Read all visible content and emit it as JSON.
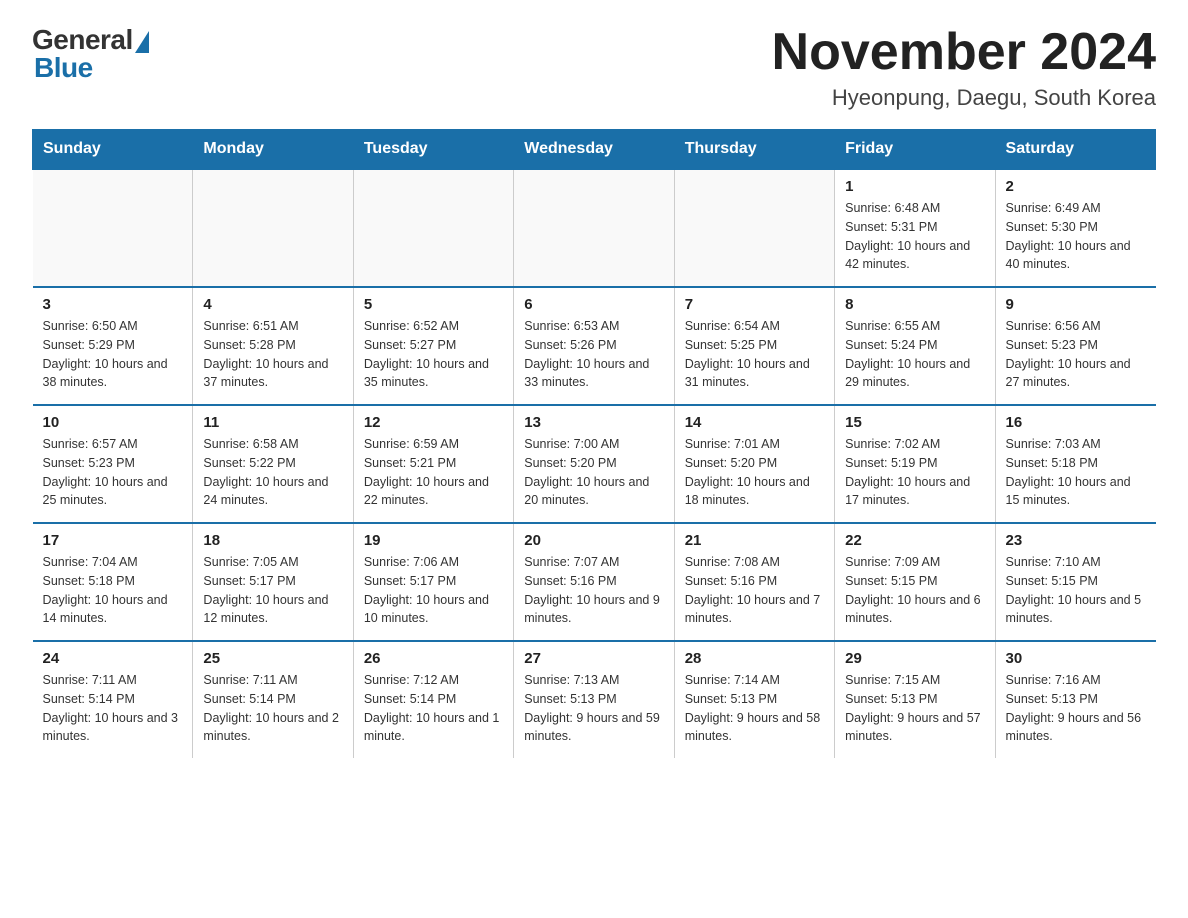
{
  "header": {
    "logo_general": "General",
    "logo_blue": "Blue",
    "month_year": "November 2024",
    "location": "Hyeonpung, Daegu, South Korea"
  },
  "days_of_week": [
    "Sunday",
    "Monday",
    "Tuesday",
    "Wednesday",
    "Thursday",
    "Friday",
    "Saturday"
  ],
  "weeks": [
    [
      {
        "num": "",
        "info": ""
      },
      {
        "num": "",
        "info": ""
      },
      {
        "num": "",
        "info": ""
      },
      {
        "num": "",
        "info": ""
      },
      {
        "num": "",
        "info": ""
      },
      {
        "num": "1",
        "info": "Sunrise: 6:48 AM\nSunset: 5:31 PM\nDaylight: 10 hours and 42 minutes."
      },
      {
        "num": "2",
        "info": "Sunrise: 6:49 AM\nSunset: 5:30 PM\nDaylight: 10 hours and 40 minutes."
      }
    ],
    [
      {
        "num": "3",
        "info": "Sunrise: 6:50 AM\nSunset: 5:29 PM\nDaylight: 10 hours and 38 minutes."
      },
      {
        "num": "4",
        "info": "Sunrise: 6:51 AM\nSunset: 5:28 PM\nDaylight: 10 hours and 37 minutes."
      },
      {
        "num": "5",
        "info": "Sunrise: 6:52 AM\nSunset: 5:27 PM\nDaylight: 10 hours and 35 minutes."
      },
      {
        "num": "6",
        "info": "Sunrise: 6:53 AM\nSunset: 5:26 PM\nDaylight: 10 hours and 33 minutes."
      },
      {
        "num": "7",
        "info": "Sunrise: 6:54 AM\nSunset: 5:25 PM\nDaylight: 10 hours and 31 minutes."
      },
      {
        "num": "8",
        "info": "Sunrise: 6:55 AM\nSunset: 5:24 PM\nDaylight: 10 hours and 29 minutes."
      },
      {
        "num": "9",
        "info": "Sunrise: 6:56 AM\nSunset: 5:23 PM\nDaylight: 10 hours and 27 minutes."
      }
    ],
    [
      {
        "num": "10",
        "info": "Sunrise: 6:57 AM\nSunset: 5:23 PM\nDaylight: 10 hours and 25 minutes."
      },
      {
        "num": "11",
        "info": "Sunrise: 6:58 AM\nSunset: 5:22 PM\nDaylight: 10 hours and 24 minutes."
      },
      {
        "num": "12",
        "info": "Sunrise: 6:59 AM\nSunset: 5:21 PM\nDaylight: 10 hours and 22 minutes."
      },
      {
        "num": "13",
        "info": "Sunrise: 7:00 AM\nSunset: 5:20 PM\nDaylight: 10 hours and 20 minutes."
      },
      {
        "num": "14",
        "info": "Sunrise: 7:01 AM\nSunset: 5:20 PM\nDaylight: 10 hours and 18 minutes."
      },
      {
        "num": "15",
        "info": "Sunrise: 7:02 AM\nSunset: 5:19 PM\nDaylight: 10 hours and 17 minutes."
      },
      {
        "num": "16",
        "info": "Sunrise: 7:03 AM\nSunset: 5:18 PM\nDaylight: 10 hours and 15 minutes."
      }
    ],
    [
      {
        "num": "17",
        "info": "Sunrise: 7:04 AM\nSunset: 5:18 PM\nDaylight: 10 hours and 14 minutes."
      },
      {
        "num": "18",
        "info": "Sunrise: 7:05 AM\nSunset: 5:17 PM\nDaylight: 10 hours and 12 minutes."
      },
      {
        "num": "19",
        "info": "Sunrise: 7:06 AM\nSunset: 5:17 PM\nDaylight: 10 hours and 10 minutes."
      },
      {
        "num": "20",
        "info": "Sunrise: 7:07 AM\nSunset: 5:16 PM\nDaylight: 10 hours and 9 minutes."
      },
      {
        "num": "21",
        "info": "Sunrise: 7:08 AM\nSunset: 5:16 PM\nDaylight: 10 hours and 7 minutes."
      },
      {
        "num": "22",
        "info": "Sunrise: 7:09 AM\nSunset: 5:15 PM\nDaylight: 10 hours and 6 minutes."
      },
      {
        "num": "23",
        "info": "Sunrise: 7:10 AM\nSunset: 5:15 PM\nDaylight: 10 hours and 5 minutes."
      }
    ],
    [
      {
        "num": "24",
        "info": "Sunrise: 7:11 AM\nSunset: 5:14 PM\nDaylight: 10 hours and 3 minutes."
      },
      {
        "num": "25",
        "info": "Sunrise: 7:11 AM\nSunset: 5:14 PM\nDaylight: 10 hours and 2 minutes."
      },
      {
        "num": "26",
        "info": "Sunrise: 7:12 AM\nSunset: 5:14 PM\nDaylight: 10 hours and 1 minute."
      },
      {
        "num": "27",
        "info": "Sunrise: 7:13 AM\nSunset: 5:13 PM\nDaylight: 9 hours and 59 minutes."
      },
      {
        "num": "28",
        "info": "Sunrise: 7:14 AM\nSunset: 5:13 PM\nDaylight: 9 hours and 58 minutes."
      },
      {
        "num": "29",
        "info": "Sunrise: 7:15 AM\nSunset: 5:13 PM\nDaylight: 9 hours and 57 minutes."
      },
      {
        "num": "30",
        "info": "Sunrise: 7:16 AM\nSunset: 5:13 PM\nDaylight: 9 hours and 56 minutes."
      }
    ]
  ]
}
